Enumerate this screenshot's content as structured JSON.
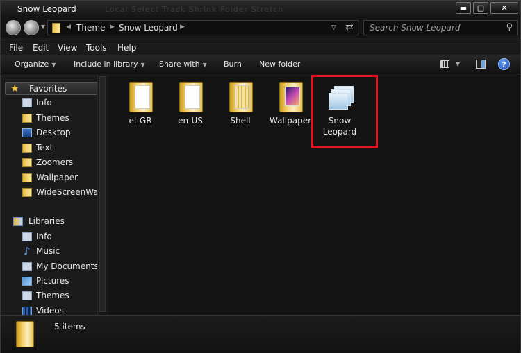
{
  "window": {
    "title": "Snow Leopard",
    "title_ghost": "Local  Select  Track  Shrink  Folder  Stretch"
  },
  "caption": {
    "minimize": "▬",
    "maximize": "□",
    "close": "✕"
  },
  "address": {
    "breadcrumbs": [
      "Theme",
      "Snow Leopard"
    ]
  },
  "search": {
    "placeholder": "Search Snow Leopard"
  },
  "menu": [
    "File",
    "Edit",
    "View",
    "Tools",
    "Help"
  ],
  "commands": [
    {
      "label": "Organize",
      "dropdown": true
    },
    {
      "label": "Include in library",
      "dropdown": true
    },
    {
      "label": "Share with",
      "dropdown": true
    },
    {
      "label": "Burn",
      "dropdown": false
    },
    {
      "label": "New folder",
      "dropdown": false
    }
  ],
  "nav": {
    "favorites": {
      "label": "Favorites",
      "icon": "star-icon"
    },
    "favorites_items": [
      {
        "label": "Info",
        "icon": "doc-icon"
      },
      {
        "label": "Themes",
        "icon": "folder-icon"
      },
      {
        "label": "Desktop",
        "icon": "desktop-icon"
      },
      {
        "label": "Text",
        "icon": "folder-icon"
      },
      {
        "label": "Zoomers",
        "icon": "folder-icon"
      },
      {
        "label": "Wallpaper",
        "icon": "folder-icon"
      },
      {
        "label": "WideScreenWal",
        "icon": "folder-icon"
      }
    ],
    "libraries": {
      "label": "Libraries",
      "icon": "library-icon"
    },
    "libraries_items": [
      {
        "label": "Info",
        "icon": "doc-icon"
      },
      {
        "label": "Music",
        "icon": "music-icon"
      },
      {
        "label": "My Documents",
        "icon": "doc-icon"
      },
      {
        "label": "Pictures",
        "icon": "pictures-icon"
      },
      {
        "label": "Themes",
        "icon": "doc-icon"
      },
      {
        "label": "Videos",
        "icon": "videos-icon"
      }
    ]
  },
  "files": [
    {
      "name": "el-GR",
      "type": "folder"
    },
    {
      "name": "en-US",
      "type": "folder"
    },
    {
      "name": "Shell",
      "type": "folder"
    },
    {
      "name": "Wallpaper",
      "type": "folder-image"
    },
    {
      "name": "Snow Leopard",
      "type": "theme-stack",
      "highlighted": true
    }
  ],
  "details": {
    "count": "5 items"
  },
  "colors": {
    "highlight": "#e01522",
    "background": "#141414"
  }
}
